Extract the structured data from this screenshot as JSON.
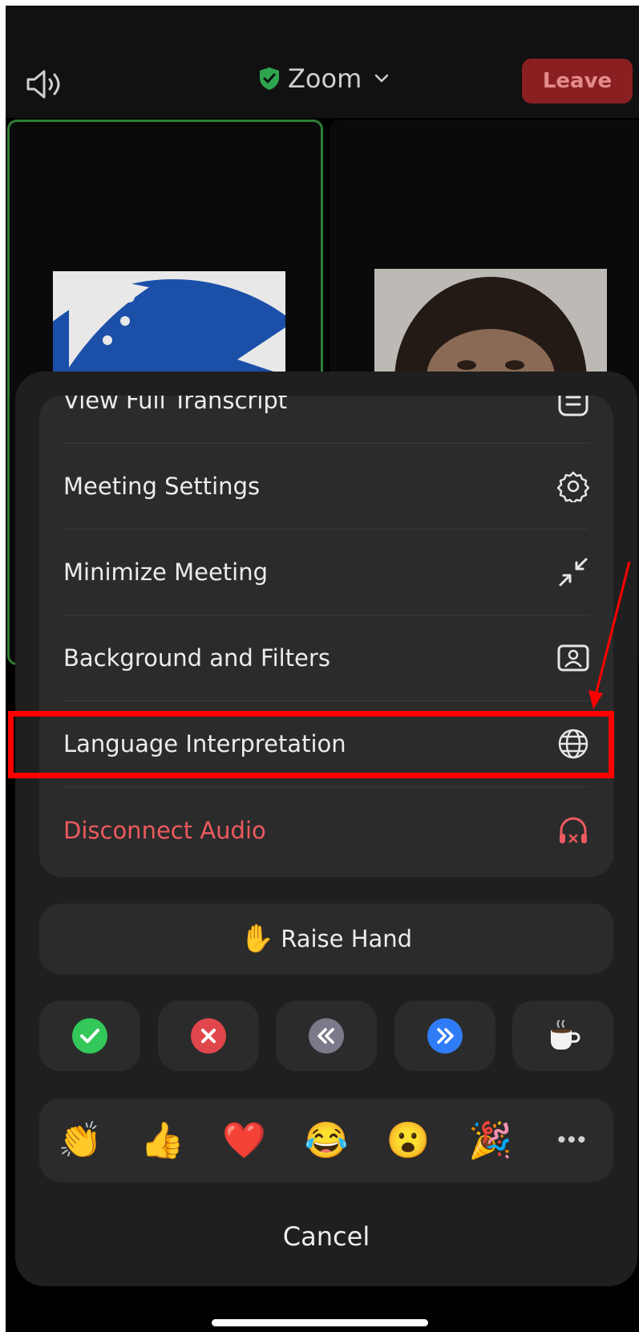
{
  "header": {
    "meeting_title": "Zoom",
    "leave_label": "Leave"
  },
  "menu": {
    "items": [
      {
        "label": "View Full Transcript",
        "icon": "transcript-icon"
      },
      {
        "label": "Meeting Settings",
        "icon": "gear-icon"
      },
      {
        "label": "Minimize Meeting",
        "icon": "minimize-icon"
      },
      {
        "label": "Background and Filters",
        "icon": "background-icon"
      },
      {
        "label": "Language Interpretation",
        "icon": "globe-icon"
      },
      {
        "label": "Disconnect Audio",
        "icon": "headphones-x-icon"
      }
    ]
  },
  "raise_hand": {
    "emoji": "✋",
    "label": "Raise Hand"
  },
  "nonverbal": [
    {
      "icon": "yes-check-icon",
      "color": "#34c759"
    },
    {
      "icon": "no-x-icon",
      "color": "#e0464b"
    },
    {
      "icon": "slower-icon",
      "color": "#7a7a8a"
    },
    {
      "icon": "faster-icon",
      "color": "#2f7cf6"
    },
    {
      "icon": "coffee-icon"
    }
  ],
  "reactions": [
    "👏",
    "👍",
    "❤️",
    "😂",
    "😮",
    "🎉",
    "•••"
  ],
  "cancel_label": "Cancel",
  "colors": {
    "accent_green": "#2e7d32",
    "leave_bg": "#8a1f22",
    "danger_text": "#ec5a5f",
    "highlight": "#ff0000"
  }
}
